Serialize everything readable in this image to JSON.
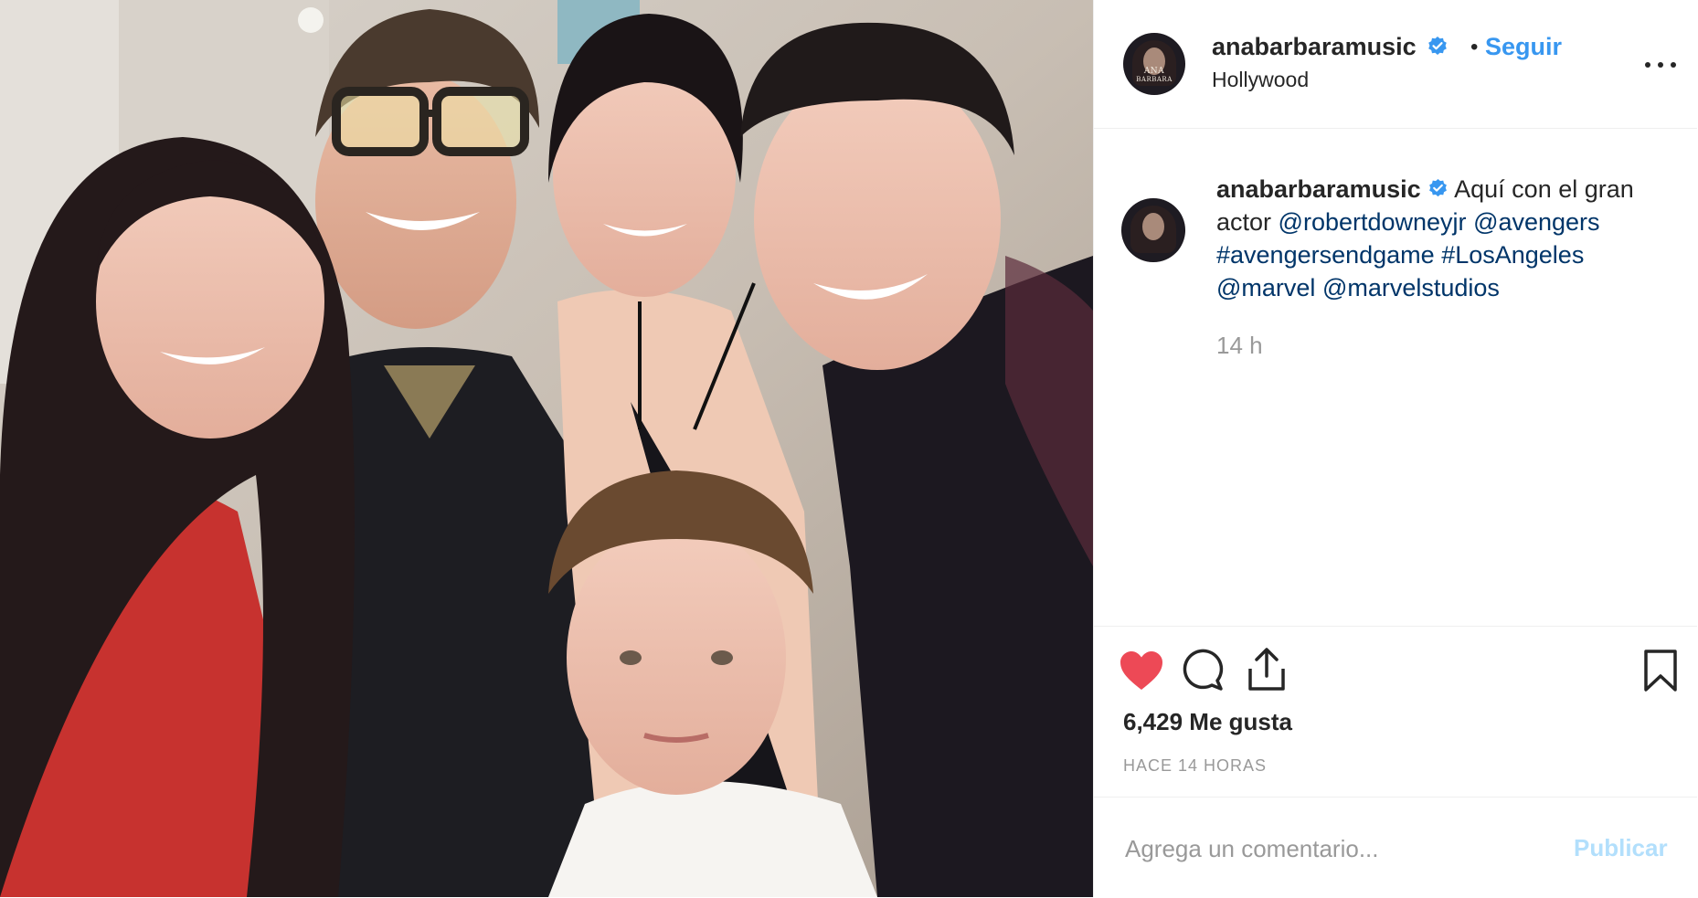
{
  "post": {
    "username": "anabarbaramusic",
    "follow_label": "Seguir",
    "separator": "•",
    "location": "Hollywood",
    "avatar_logo_line1": "ANA",
    "avatar_logo_line2": "BARBARA"
  },
  "caption": {
    "username": "anabarbaramusic",
    "text_lead": "Aquí con el gran actor",
    "mention_1": "@robertdowneyjr",
    "mention_2": "@avengers",
    "hashtag_1": "#avengersendgame",
    "hashtag_2": "#LosAngeles",
    "mention_3": "@marvel",
    "mention_4": "@marvelstudios",
    "time": "14 h"
  },
  "engagement": {
    "likes": "6,429 Me gusta",
    "time_ago": "HACE 14 HORAS"
  },
  "comment": {
    "placeholder": "Agrega un comentario...",
    "publish_label": "Publicar"
  },
  "colors": {
    "accent": "#3897f0",
    "like_red": "#ed4956",
    "link": "#003569",
    "muted": "#999999",
    "publish_disabled": "#b2dffc"
  },
  "icons": [
    "verified-badge-icon",
    "more-options-icon",
    "heart-icon",
    "comment-icon",
    "share-icon",
    "bookmark-icon"
  ]
}
